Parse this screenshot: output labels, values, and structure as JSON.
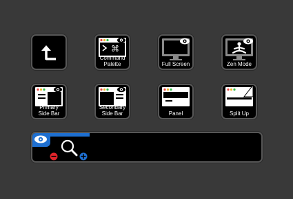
{
  "keys": [
    {
      "id": "back",
      "label": ""
    },
    {
      "id": "command-palette",
      "label": "Command\nPalette"
    },
    {
      "id": "full-screen",
      "label": "Full Screen"
    },
    {
      "id": "zen-mode",
      "label": "Zen Mode"
    },
    {
      "id": "primary-side-bar",
      "label": "Primary\nSide Bar"
    },
    {
      "id": "secondary-side-bar",
      "label": "Secondary\nSide Bar"
    },
    {
      "id": "panel",
      "label": "Panel"
    },
    {
      "id": "split-up",
      "label": "Split Up"
    }
  ],
  "dial": {
    "progress": 0.25,
    "accent": "#1e6fd0",
    "icons": [
      "eye-icon",
      "magnifier-icon",
      "zoom-out-icon",
      "zoom-in-icon"
    ]
  },
  "colors": {
    "traffic_red": "#e8473f",
    "traffic_yellow": "#f0b429",
    "traffic_green": "#2fbf4a",
    "monitor_gray": "#8a8a8a"
  }
}
